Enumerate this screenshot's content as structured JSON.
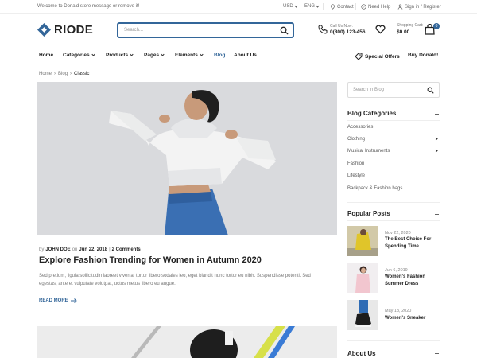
{
  "topbar": {
    "welcome": "Welcome to Donald store message or remove it!",
    "currency": "USD",
    "language": "ENG",
    "contact": "Contact",
    "help": "Need Help",
    "signin": "Sign in / Register"
  },
  "header": {
    "logo": "RIODE",
    "search_placeholder": "Search...",
    "call_label": "Call Us Now:",
    "call_number": "0(800) 123-456",
    "cart_label": "Shopping Cart:",
    "cart_total": "$0.00",
    "cart_count": "0"
  },
  "nav": {
    "items": [
      {
        "label": "Home"
      },
      {
        "label": "Categories"
      },
      {
        "label": "Products"
      },
      {
        "label": "Pages"
      },
      {
        "label": "Elements"
      },
      {
        "label": "Blog"
      },
      {
        "label": "About Us"
      }
    ],
    "special_offers": "Special Offers",
    "buy": "Buy Donald!"
  },
  "breadcrumb": {
    "home": "Home",
    "blog": "Blog",
    "current": "Classic"
  },
  "post": {
    "by": "by",
    "author": "JOHN DOE",
    "on": "on",
    "date": "Jun 22, 2018",
    "divider": "|",
    "comments": "2 Comments",
    "title": "Explore Fashion Trending for Women in Autumn 2020",
    "excerpt": "Sed pretium, ligula sollicitudin laoreet viverra, tortor libero sodales leo, eget blandit nunc tortor eu nibh. Suspendisse potenti. Sed egestas, ante et vulputate volutpat, uctus metus libero eu augue.",
    "read_more": "READ MORE"
  },
  "sidebar": {
    "search_placeholder": "Search in Blog",
    "categories_title": "Blog Categories",
    "categories": [
      {
        "label": "Accessories"
      },
      {
        "label": "Clothing"
      },
      {
        "label": "Musical Instruments"
      },
      {
        "label": "Fashion"
      },
      {
        "label": "Lifestyle"
      },
      {
        "label": "Backpack & Fashion bags"
      }
    ],
    "popular_title": "Popular Posts",
    "popular": [
      {
        "date": "Nov 22, 2020",
        "title": "The Best Choice For Spending Time"
      },
      {
        "date": "Jun 6, 2019",
        "title": "Women's Fashion Summer Dress"
      },
      {
        "date": "May 13, 2020",
        "title": "Women's Sneaker"
      }
    ],
    "about_title": "About Us"
  },
  "colors": {
    "accent": "#336699",
    "text": "#222222",
    "muted": "#777777"
  }
}
